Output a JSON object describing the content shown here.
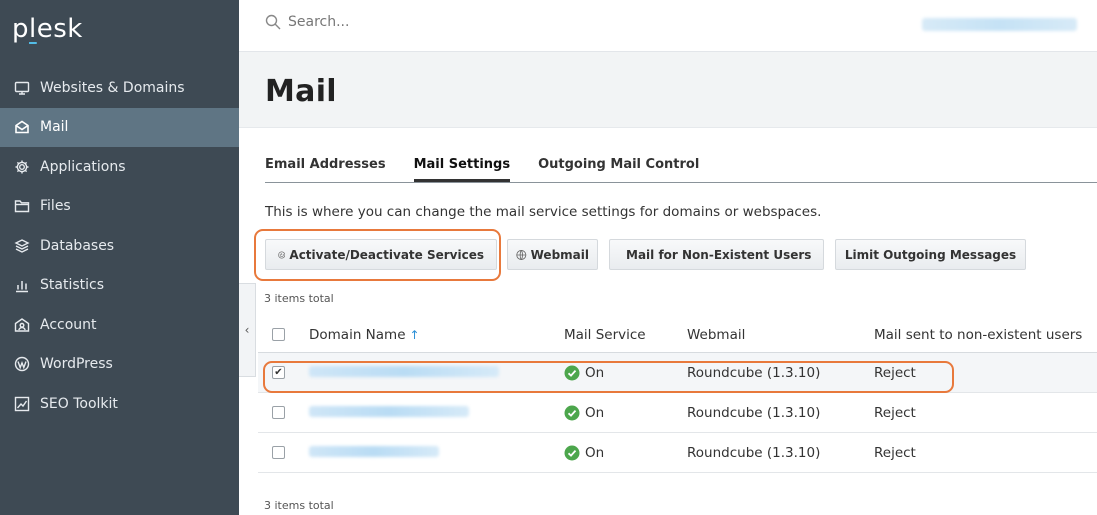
{
  "app": {
    "logo_prefix": "p",
    "logo_underlined": "l",
    "logo_suffix": "esk"
  },
  "sidebar": {
    "items": [
      {
        "label": "Websites & Domains",
        "icon": "monitor-icon"
      },
      {
        "label": "Mail",
        "icon": "mail-icon",
        "active": true
      },
      {
        "label": "Applications",
        "icon": "gear-icon"
      },
      {
        "label": "Files",
        "icon": "folder-icon"
      },
      {
        "label": "Databases",
        "icon": "database-icon"
      },
      {
        "label": "Statistics",
        "icon": "bar-chart-icon"
      },
      {
        "label": "Account",
        "icon": "account-icon"
      },
      {
        "label": "WordPress",
        "icon": "wordpress-icon"
      },
      {
        "label": "SEO Toolkit",
        "icon": "seo-chart-icon"
      }
    ],
    "collapse_glyph": "‹"
  },
  "search": {
    "placeholder": "Search..."
  },
  "page": {
    "title": "Mail",
    "tabs": [
      {
        "label": "Email Addresses"
      },
      {
        "label": "Mail Settings",
        "active": true
      },
      {
        "label": "Outgoing Mail Control"
      }
    ],
    "description": "This is where you can change the mail service settings for domains or webspaces."
  },
  "toolbar": {
    "activate_label": "Activate/Deactivate Services",
    "webmail_label": "Webmail",
    "nonexistent_label": "Mail for Non-Existent Users",
    "limit_label": "Limit Outgoing Messages"
  },
  "list": {
    "total_top": "3 items total",
    "total_bottom": "3 items total",
    "columns": {
      "domain": "Domain Name",
      "sort_glyph": "↑",
      "service": "Mail Service",
      "webmail": "Webmail",
      "nonexistent": "Mail sent to non-existent users"
    },
    "rows": [
      {
        "checked": true,
        "service": "On",
        "webmail": "Roundcube (1.3.10)",
        "nonexistent": "Reject"
      },
      {
        "checked": false,
        "service": "On",
        "webmail": "Roundcube (1.3.10)",
        "nonexistent": "Reject"
      },
      {
        "checked": false,
        "service": "On",
        "webmail": "Roundcube (1.3.10)",
        "nonexistent": "Reject"
      }
    ]
  },
  "colors": {
    "sidebar_bg": "#3e4a54",
    "sidebar_active": "#5f7584",
    "status_ok": "#4ca64c",
    "highlight": "#e8793c",
    "sort_arrow": "#2b8fd6"
  }
}
